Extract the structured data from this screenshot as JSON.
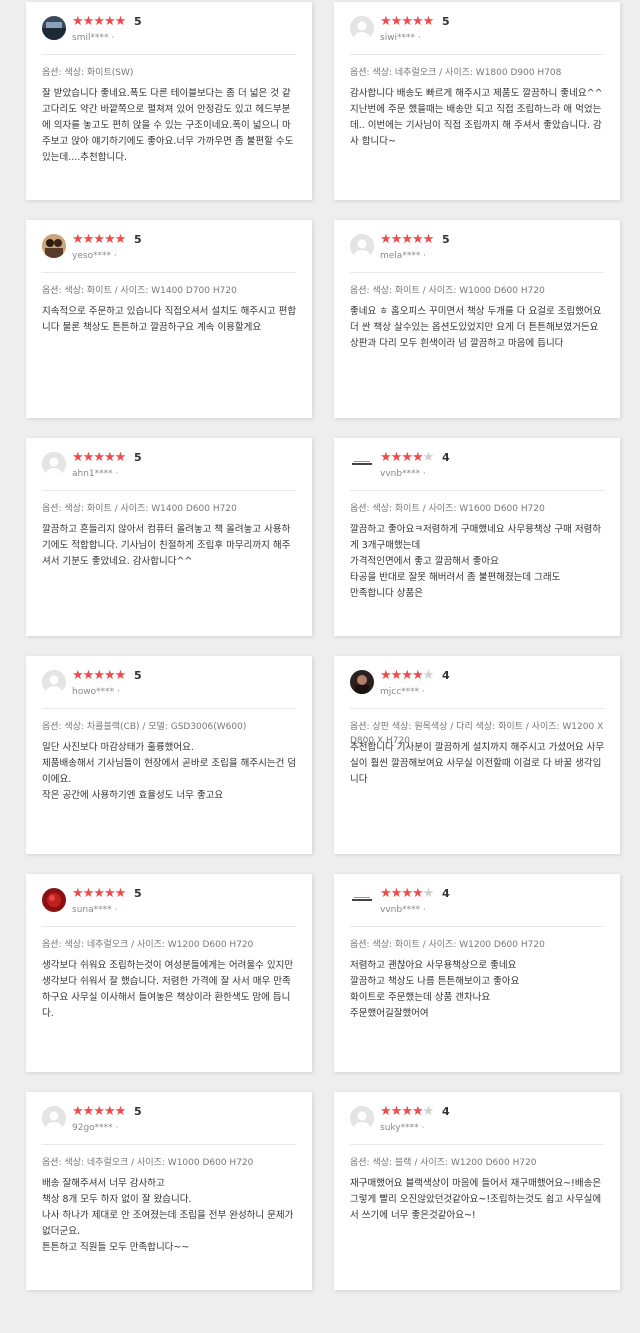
{
  "colors": {
    "star_on": "#f04a4a",
    "star_off": "#cfcfcf",
    "background": "#eeeeee"
  },
  "reviews": [
    {
      "user": "smil**** ·",
      "rating": 5,
      "score_label": "5",
      "options": "옵션: 색상: 화이트(SW)",
      "text": "잘 받았습니다 좋네요.폭도 다른 테이블보다는 좀 더 넓은 것 같고다리도 약간 바깥쪽으로 펼쳐져 있어 안정감도 있고 헤드부분에 의자를 놓고도 편히 앉을 수 있는 구조이네요.폭이 넓으니 마주보고 앉아 얘기하기에도 좋아요.너무 가까우면 좀 불편할 수도 있는데....추천합니다.",
      "avatar": "photo-dark"
    },
    {
      "user": "siwi**** ·",
      "rating": 5,
      "score_label": "5",
      "options": "옵션: 색상: 네추럴오크 / 사이즈: W1800 D900 H708",
      "text": "감사합니다 배송도 빠르게 해주시고 제품도 깔끔하니 좋네요^^ 지난번에 주문 했을때는 배송만 되고 직접 조립하느라 애 먹었는데.. 이번에는 기사님이 직접 조립까지 해 주셔서 좋았습니다. 감사 합니다~",
      "avatar": "default"
    },
    {
      "user": "yeso**** ·",
      "rating": 5,
      "score_label": "5",
      "options": "옵션: 색상: 화이트 / 사이즈: W1400 D700 H720",
      "text": "지속적으로 주문하고 있습니다 직접오셔서 설치도 해주시고 편합니다 물론 책상도 튼튼하고 깔끔하구요 계속 이용할게요",
      "avatar": "photo-people"
    },
    {
      "user": "mela**** ·",
      "rating": 5,
      "score_label": "5",
      "options": "옵션: 색상: 화이트 / 사이즈: W1000 D600 H720",
      "text": "좋네요 ㅎ 홈오피스 꾸미면서 책상 두개를 다 요걸로 조립했어요 더 싼 책상 살수있는 옵션도있었지만 요게 더 튼튼해보였거든요 상판과 다리 모두 흰색이라 넘 깔끔하고 마음에 듭니다",
      "avatar": "default"
    },
    {
      "user": "ahn1**** ·",
      "rating": 5,
      "score_label": "5",
      "options": "옵션: 색상: 화이트 / 사이즈: W1400 D600 H720",
      "text": "깔끔하고 흔들리지 않아서 컴퓨터 올려놓고 책 올려놓고 사용하기에도 적합합니다. 기사님이 친절하게 조립후 마무리까지 해주셔서 기분도 좋았네요. 감사합니다^^",
      "avatar": "default"
    },
    {
      "user": "vvnb**** ·",
      "rating": 4,
      "score_label": "4",
      "options": "옵션: 색상: 화이트 / 사이즈: W1600 D600 H720",
      "text": "깔끔하고 좋아요ㅋ저렴하게 구매했네요 사무용책상 구매 저렴하게 3개구매했는데\n가격적인면에서 좋고 깔끔해서 좋아요\n타공을 반대로 잘못 해버려서 좀 불편해졌는데 그래도\n만족합니다 상품은",
      "avatar": "logo"
    },
    {
      "user": "howo**** ·",
      "rating": 5,
      "score_label": "5",
      "options": "옵션: 색상: 차콜블랙(CB) / 모델: GSD3006(W600)",
      "text": "일단 사진보다 마감상태가 훌륭했어요.\n제품배송해서 기사님들이 현장에서 곧바로 조립을 해주시는건 덤이에요.\n작은 공간에 사용하기엔 효율성도 너무 좋고요",
      "avatar": "default"
    },
    {
      "user": "mjcc**** ·",
      "rating": 4,
      "score_label": "4",
      "options": "옵션: 상판 색상: 원목색상 / 다리 색상: 화이트 / 사이즈: W1200 X D800 X H720",
      "text": "추천합니다 기사분이 깔끔하게 설치까지 해주시고 가셨어요 사무실이 훨씬 깔끔해보여요 사무실 이전할때 이걸로 다 바꿀 생각입니다",
      "avatar": "photo-dark2"
    },
    {
      "user": "suna**** ·",
      "rating": 5,
      "score_label": "5",
      "options": "옵션: 색상: 네추럴오크 / 사이즈: W1200 D600 H720",
      "text": "생각보다 쉬워요 조립하는것이 여성분들에게는 어려울수 있지만 생각보다 쉬워서  잘 했습니다. 저렴한 가격에 잘 사서 매우 만족하구요 사무실 이사해서  들여놓은 책상이라 환한색도 맘에 듭니다.",
      "avatar": "photo-red"
    },
    {
      "user": "vvnb**** ·",
      "rating": 4,
      "score_label": "4",
      "options": "옵션: 색상: 화이트 / 사이즈: W1200 D600 H720",
      "text": "저렴하고 괜찮아요 사무용책상으로 좋네요\n깔끔하고 책상도 나름 튼튼해보이고 좋아요\n화이트로 주문했는데 상품 갠차나요\n주문했어길잘했어여",
      "avatar": "logo"
    },
    {
      "user": "92go**** ·",
      "rating": 5,
      "score_label": "5",
      "options": "옵션: 색상: 네추럴오크 / 사이즈: W1000 D600 H720",
      "text": "배송 잘해주셔서 너무 감사하고\n책상 8개 모두 하자 없이 잘 왔습니다.\n나사 하나가 제대로 안 조여졌는데 조립을 전부 완성하니 문제가 없더군요.\n튼튼하고 직원들 모두 만족합니다~~",
      "avatar": "default"
    },
    {
      "user": "suky**** ·",
      "rating": 4,
      "score_label": "4",
      "options": "옵션: 색상: 블랙 / 사이즈: W1200 D600 H720",
      "text": "재구매했어요 블랙색상이 마음에 들어서 재구매했어요~!배송은 그렇게 빨리 오진않았던것같아요~!조립하는것도 쉽고 사무실에서 쓰기에 너무 좋은것같아요~!",
      "avatar": "default"
    }
  ]
}
